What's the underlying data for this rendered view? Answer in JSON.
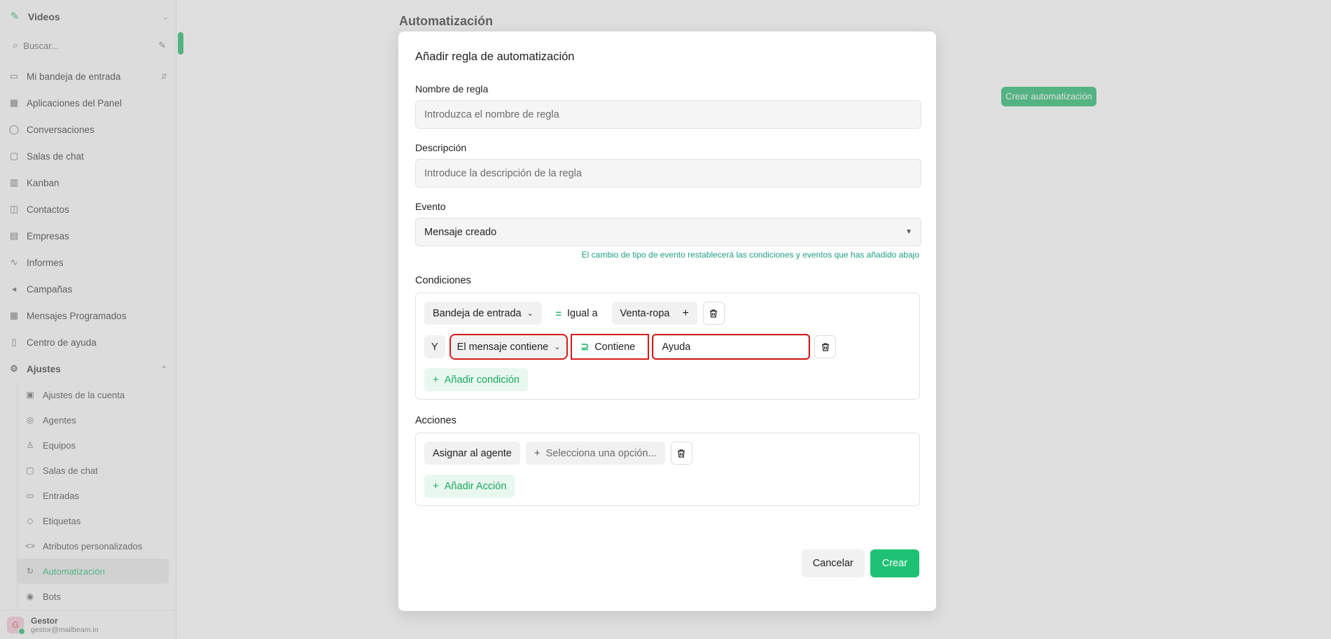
{
  "sidebar": {
    "brand": "Videos",
    "search_placeholder": "Buscar...",
    "items": [
      {
        "label": "Mi bandeja de entrada",
        "icon": "inbox-icon"
      },
      {
        "label": "Aplicaciones del Panel",
        "icon": "grid-icon"
      },
      {
        "label": "Conversaciones",
        "icon": "chat-icon"
      },
      {
        "label": "Salas de chat",
        "icon": "chat-room-icon"
      },
      {
        "label": "Kanban",
        "icon": "kanban-icon"
      },
      {
        "label": "Contactos",
        "icon": "contacts-icon"
      },
      {
        "label": "Empresas",
        "icon": "building-icon"
      },
      {
        "label": "Informes",
        "icon": "chart-icon"
      },
      {
        "label": "Campañas",
        "icon": "megaphone-icon"
      },
      {
        "label": "Mensajes Programados",
        "icon": "calendar-icon"
      },
      {
        "label": "Centro de ayuda",
        "icon": "book-icon"
      }
    ],
    "settings_label": "Ajustes",
    "sub_items": [
      {
        "label": "Ajustes de la cuenta",
        "icon": "settings-icon"
      },
      {
        "label": "Agentes",
        "icon": "agent-icon"
      },
      {
        "label": "Equipos",
        "icon": "team-icon"
      },
      {
        "label": "Salas de chat",
        "icon": "chat-room-icon"
      },
      {
        "label": "Entradas",
        "icon": "inbox-icon"
      },
      {
        "label": "Etiquetas",
        "icon": "tag-icon"
      },
      {
        "label": "Atributos personalizados",
        "icon": "code-icon"
      },
      {
        "label": "Automatización",
        "icon": "automation-icon"
      },
      {
        "label": "Bots",
        "icon": "bot-icon"
      }
    ],
    "user": {
      "name": "Gestor",
      "email": "gestor@mailbeam.io"
    }
  },
  "page": {
    "title": "Automatización",
    "create_button": "Crear automatización"
  },
  "modal": {
    "title": "Añadir regla de automatización",
    "rule_name": {
      "label": "Nombre de regla",
      "placeholder": "Introduzca el nombre de regla",
      "value": ""
    },
    "description": {
      "label": "Descripción",
      "placeholder": "Introduce la descripción de la regla",
      "value": ""
    },
    "event": {
      "label": "Evento",
      "selected": "Mensaje creado",
      "hint": "El cambio de tipo de evento restablecerá las condiciones y eventos que has añadido abajo"
    },
    "conditions": {
      "title": "Condiciones",
      "rows": [
        {
          "connector": "",
          "attribute": "Bandeja de entrada",
          "operator_symbol": "=",
          "operator": "Igual a",
          "value": "Venta-ropa"
        },
        {
          "connector": "Y",
          "attribute": "El mensaje contiene",
          "operator_symbol": "⊇",
          "operator": "Contiene",
          "value": "Ayuda"
        }
      ],
      "add_label": "Añadir condición"
    },
    "actions": {
      "title": "Acciones",
      "rows": [
        {
          "action": "Asignar al agente",
          "value_placeholder": "Selecciona una opción..."
        }
      ],
      "add_label": "Añadir Acción"
    },
    "cancel_label": "Cancelar",
    "create_label": "Crear"
  },
  "colors": {
    "accent": "#1fc274",
    "highlight": "#d61a1a",
    "hint": "#1f9e82"
  }
}
